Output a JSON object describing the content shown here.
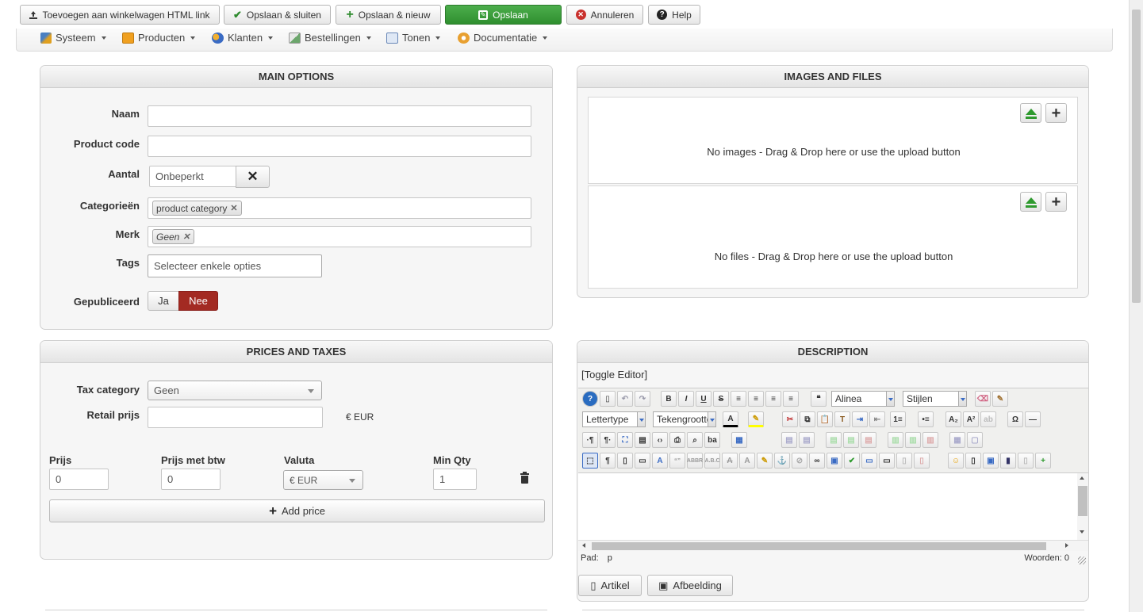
{
  "toolbar": {
    "add_to_cart_html": "Toevoegen aan winkelwagen HTML link",
    "save_close": "Opslaan & sluiten",
    "save_new": "Opslaan & nieuw",
    "save": "Opslaan",
    "cancel": "Annuleren",
    "help": "Help"
  },
  "menu": {
    "items": [
      {
        "label": "Systeem",
        "icon": "tools-icon"
      },
      {
        "label": "Producten",
        "icon": "box-icon"
      },
      {
        "label": "Klanten",
        "icon": "users-icon"
      },
      {
        "label": "Bestellingen",
        "icon": "orders-icon"
      },
      {
        "label": "Tonen",
        "icon": "display-icon"
      },
      {
        "label": "Documentatie",
        "icon": "docs-icon"
      }
    ]
  },
  "main_options": {
    "title": "MAIN OPTIONS",
    "naam_label": "Naam",
    "naam_value": "",
    "product_code_label": "Product code",
    "product_code_value": "",
    "aantal_label": "Aantal",
    "aantal_value": "Onbeperkt",
    "categorieen_label": "Categorieën",
    "category_tag": "product category",
    "merk_label": "Merk",
    "merk_tag": "Geen",
    "tags_label": "Tags",
    "tags_placeholder": "Selecteer enkele opties",
    "gepubliceerd_label": "Gepubliceerd",
    "ja": "Ja",
    "nee": "Nee"
  },
  "images_files": {
    "title": "IMAGES AND FILES",
    "no_images": "No images - Drag & Drop here or use the upload button",
    "no_files": "No files - Drag & Drop here or use the upload button"
  },
  "prices": {
    "title": "PRICES AND TAXES",
    "tax_category_label": "Tax category",
    "tax_category_value": "Geen",
    "retail_label": "Retail prijs",
    "retail_value": "",
    "retail_currency": "€ EUR",
    "col_prijs": "Prijs",
    "col_prijs_btw": "Prijs met btw",
    "col_valuta": "Valuta",
    "col_min_qty": "Min Qty",
    "row_prijs": "0",
    "row_prijs_btw": "0",
    "row_valuta": "€ EUR",
    "row_min_qty": "1",
    "add_price": "Add price"
  },
  "description": {
    "title": "DESCRIPTION",
    "toggle": "[Toggle Editor]",
    "format_select": "Alinea",
    "styles_select": "Stijlen",
    "font_select": "Lettertype",
    "size_select": "Tekengrootte",
    "path_label": "Pad:",
    "path_value": "p",
    "words": "Woorden: 0",
    "artikel": "Artikel",
    "afbeelding": "Afbeelding"
  }
}
